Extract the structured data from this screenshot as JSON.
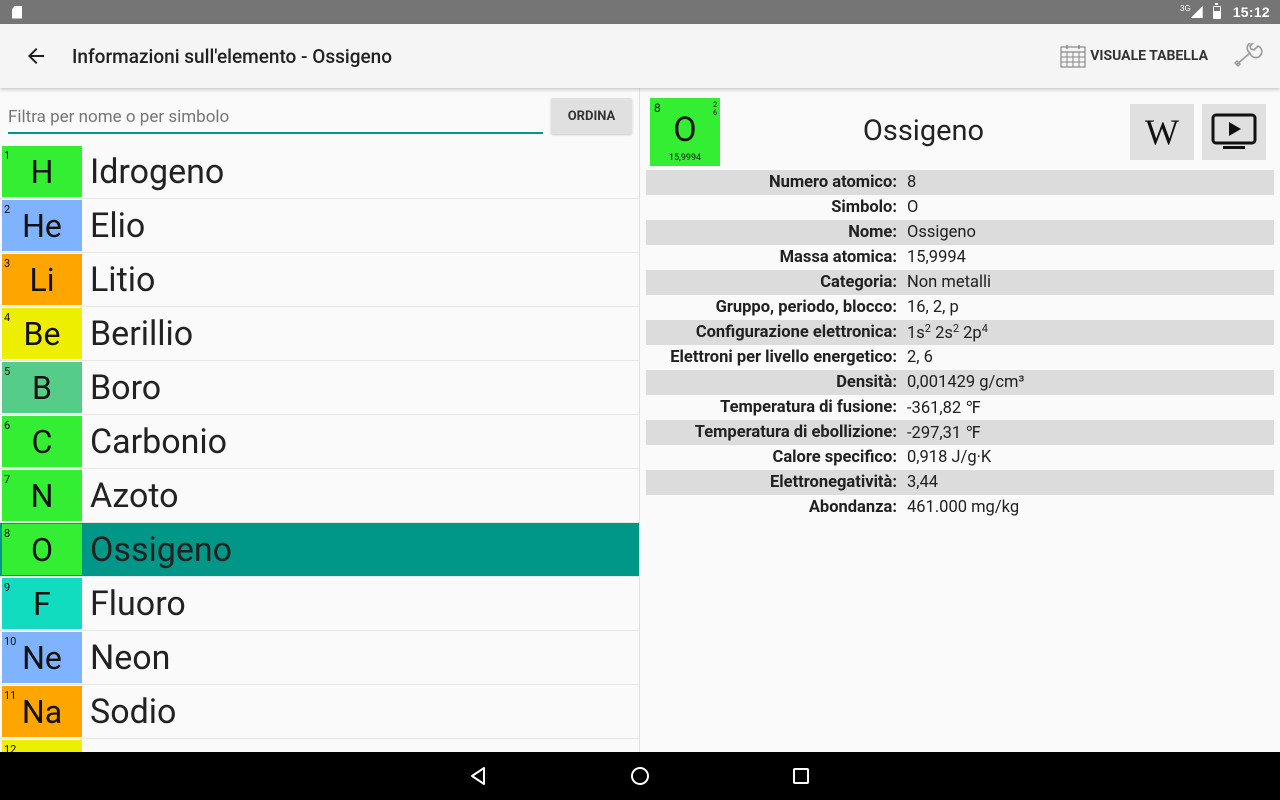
{
  "status_bar": {
    "network": "3G",
    "time": "15:12"
  },
  "app_bar": {
    "title": "Informazioni sull'elemento - Ossigeno",
    "table_view_label": "VISUALE TABELLA"
  },
  "filter": {
    "placeholder": "Filtra per nome o per simbolo",
    "value": "",
    "sort_label": "ORDINA"
  },
  "elements": [
    {
      "number": "1",
      "symbol": "H",
      "name": "Idrogeno",
      "color": "#33ee33"
    },
    {
      "number": "2",
      "symbol": "He",
      "name": "Elio",
      "color": "#7fb2ff"
    },
    {
      "number": "3",
      "symbol": "Li",
      "name": "Litio",
      "color": "#ffa500"
    },
    {
      "number": "4",
      "symbol": "Be",
      "name": "Berillio",
      "color": "#eeee00"
    },
    {
      "number": "5",
      "symbol": "B",
      "name": "Boro",
      "color": "#55cc88"
    },
    {
      "number": "6",
      "symbol": "C",
      "name": "Carbonio",
      "color": "#33ee33"
    },
    {
      "number": "7",
      "symbol": "N",
      "name": "Azoto",
      "color": "#33ee33"
    },
    {
      "number": "8",
      "symbol": "O",
      "name": "Ossigeno",
      "color": "#33ee33"
    },
    {
      "number": "9",
      "symbol": "F",
      "name": "Fluoro",
      "color": "#11dcc0"
    },
    {
      "number": "10",
      "symbol": "Ne",
      "name": "Neon",
      "color": "#7fb2ff"
    },
    {
      "number": "11",
      "symbol": "Na",
      "name": "Sodio",
      "color": "#ffa500"
    },
    {
      "number": "12",
      "symbol": "",
      "name": "",
      "color": "#eeee00"
    }
  ],
  "selected_index": 7,
  "detail": {
    "number": "8",
    "symbol": "O",
    "shells": [
      "2",
      "6"
    ],
    "mass": "15,9994",
    "name": "Ossigeno",
    "tile_color": "#33ee33",
    "wiki_label": "W",
    "properties": [
      {
        "label": "Numero atomico:",
        "value": "8"
      },
      {
        "label": "Simbolo:",
        "value": "O"
      },
      {
        "label": "Nome:",
        "value": "Ossigeno"
      },
      {
        "label": "Massa atomica:",
        "value": "15,9994"
      },
      {
        "label": "Categoria:",
        "value": "Non metalli"
      },
      {
        "label": "Gruppo, periodo, blocco:",
        "value": "16, 2, p"
      },
      {
        "label": "Configurazione elettronica:",
        "value": "",
        "config": [
          {
            "base": "1s",
            "sup": "2"
          },
          {
            "base": "2s",
            "sup": "2"
          },
          {
            "base": "2p",
            "sup": "4"
          }
        ]
      },
      {
        "label": "Elettroni per livello energetico:",
        "value": "2, 6"
      },
      {
        "label": "Densità:",
        "value": "0,001429 g/cm³"
      },
      {
        "label": "Temperatura di fusione:",
        "value": "-361,82 ℉"
      },
      {
        "label": "Temperatura di ebollizione:",
        "value": "-297,31 ℉"
      },
      {
        "label": "Calore specifico:",
        "value": "0,918 J/g·K"
      },
      {
        "label": "Elettronegatività:",
        "value": "3,44"
      },
      {
        "label": "Abondanza:",
        "value": "461.000 mg/kg"
      }
    ]
  },
  "icons": {
    "back": "arrow-back-icon",
    "table": "calendar-grid-icon",
    "settings": "wrench-icon",
    "wiki": "wikipedia-icon",
    "video": "video-play-icon",
    "nav_back": "triangle-back-icon",
    "nav_home": "circle-home-icon",
    "nav_recents": "square-recents-icon"
  },
  "colors": {
    "accent": "#009688",
    "selected_row": "#009688"
  }
}
